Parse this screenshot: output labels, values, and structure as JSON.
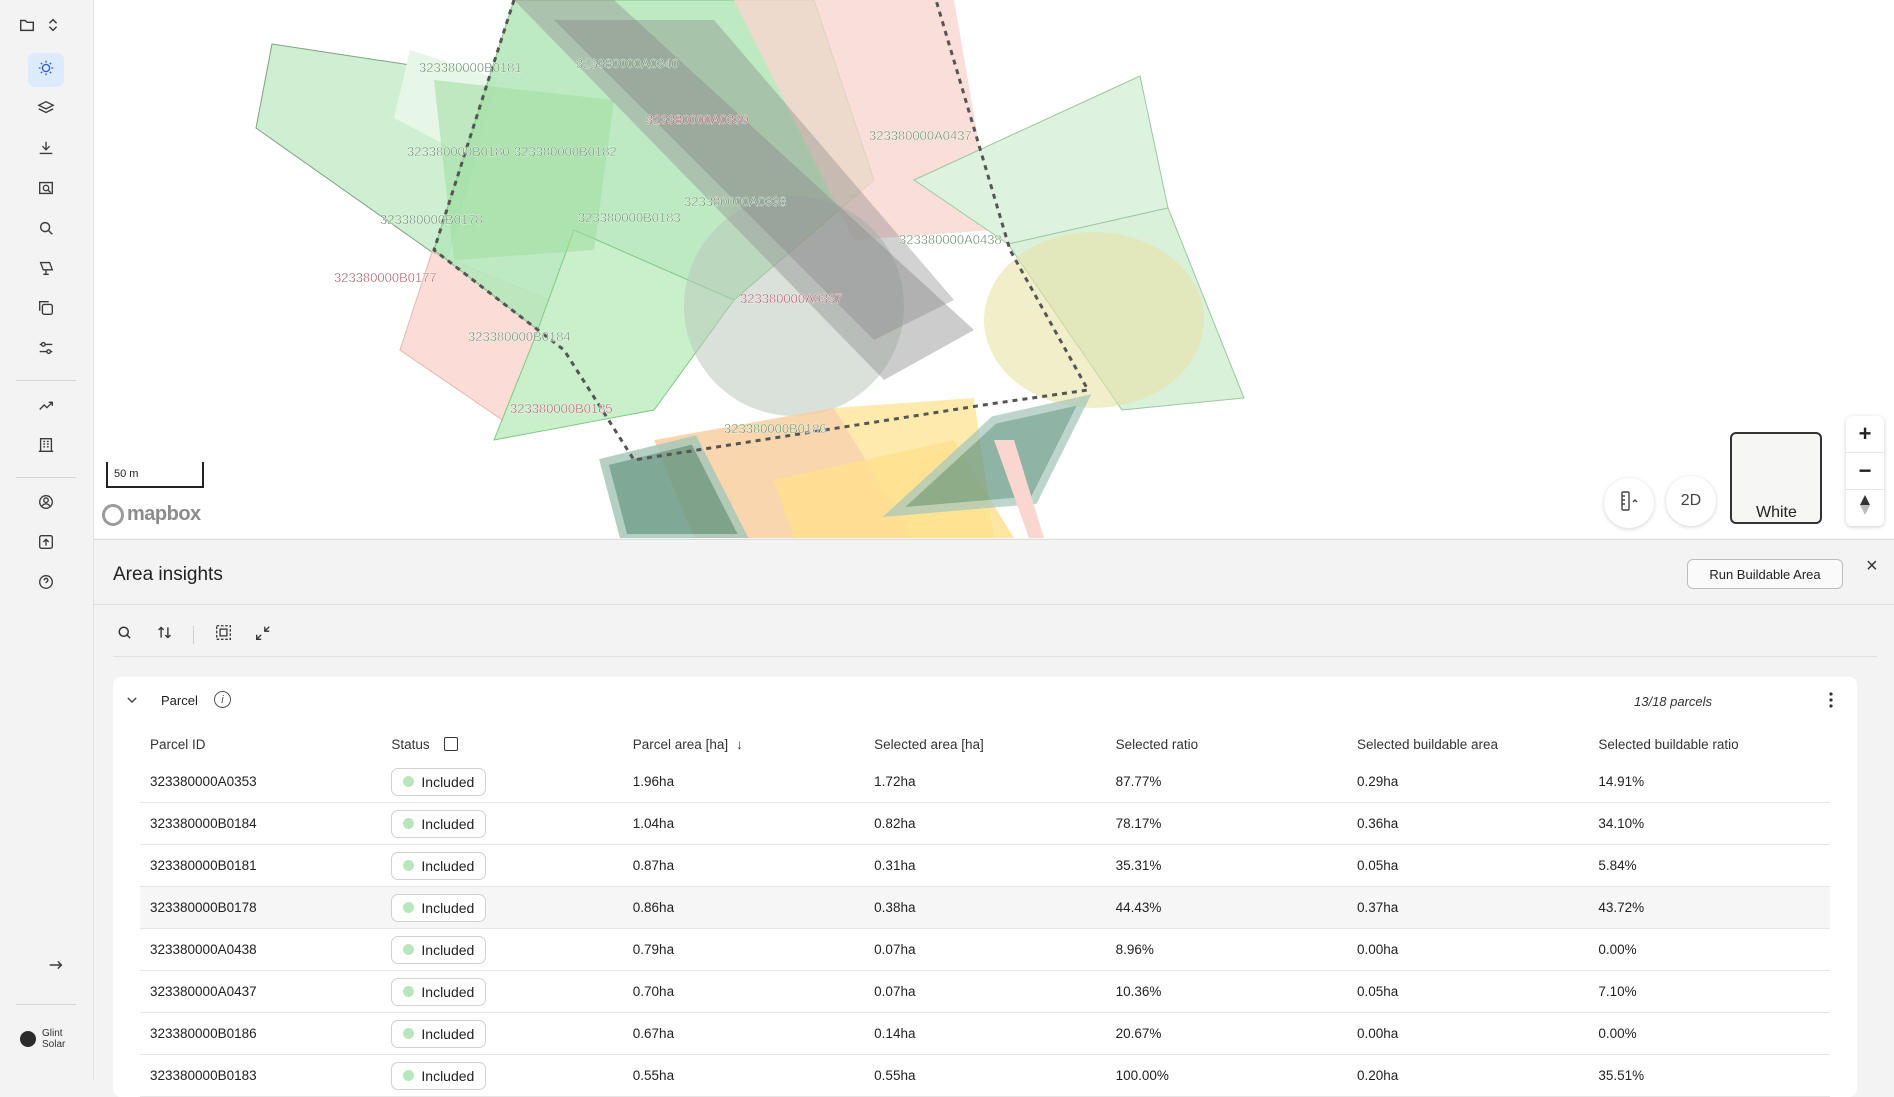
{
  "sidebar": {
    "top": {
      "icon": "folder-icon"
    },
    "items": [
      {
        "name": "insights",
        "icon": "sun-gear-icon",
        "active": true
      },
      {
        "name": "layers",
        "icon": "layers-icon"
      },
      {
        "name": "import",
        "icon": "download-icon"
      },
      {
        "name": "search-area",
        "icon": "map-search-icon"
      },
      {
        "name": "search",
        "icon": "search-icon"
      },
      {
        "name": "solar",
        "icon": "solar-panel-icon"
      },
      {
        "name": "copy",
        "icon": "copy-icon"
      },
      {
        "name": "settings",
        "icon": "sliders-icon"
      },
      {
        "name": "analytics",
        "icon": "trend-icon"
      },
      {
        "name": "buildings",
        "icon": "building-icon"
      },
      {
        "name": "account",
        "icon": "user-icon"
      },
      {
        "name": "export",
        "icon": "upload-icon"
      },
      {
        "name": "help",
        "icon": "help-icon"
      }
    ],
    "brand_line1": "Glint",
    "brand_line2": "Solar"
  },
  "map": {
    "scale_label": "50 m",
    "attribution": "mapbox",
    "view_mode": "2D",
    "base_style": "White",
    "parcel_labels": [
      {
        "id": "323380000B0181",
        "color": "#4a7a4c"
      },
      {
        "id": "323380000A0340",
        "color": "#4a7a4c"
      },
      {
        "id": "323380000A0339",
        "color": "#a13c48"
      },
      {
        "id": "323380000A0437",
        "color": "#4a7a4c"
      },
      {
        "id": "323380000B0180",
        "color": "#4a7a4c"
      },
      {
        "id": "323380000B0182",
        "color": "#4a7a4c"
      },
      {
        "id": "323380000A0338",
        "color": "#4a7a4c"
      },
      {
        "id": "323380000B0183",
        "color": "#4a7a4c"
      },
      {
        "id": "323380000B0178",
        "color": "#4a7a4c"
      },
      {
        "id": "323380000A0438",
        "color": "#4a7a4c"
      },
      {
        "id": "323380000B0177",
        "color": "#a13c48"
      },
      {
        "id": "323380000A0337",
        "color": "#a13c48"
      },
      {
        "id": "323380000B0184",
        "color": "#4a7a4c"
      },
      {
        "id": "323380000B0185",
        "color": "#a13c48"
      },
      {
        "id": "323380000B0186",
        "color": "#4a7a4c"
      }
    ]
  },
  "panel": {
    "title": "Area insights",
    "run_button": "Run Buildable Area",
    "card_title": "Parcel",
    "count": "13/18 parcels",
    "columns": [
      "Parcel ID",
      "Status",
      "Parcel area [ha]",
      "Selected area [ha]",
      "Selected ratio",
      "Selected buildable area",
      "Selected buildable ratio"
    ],
    "sorted_column_indicator": "↓",
    "rows": [
      {
        "id": "323380000A0353",
        "status": "Included",
        "parcel_area": "1.96ha",
        "selected_area": "1.72ha",
        "selected_ratio": "87.77%",
        "buildable_area": "0.29ha",
        "buildable_ratio": "14.91%"
      },
      {
        "id": "323380000B0184",
        "status": "Included",
        "parcel_area": "1.04ha",
        "selected_area": "0.82ha",
        "selected_ratio": "78.17%",
        "buildable_area": "0.36ha",
        "buildable_ratio": "34.10%"
      },
      {
        "id": "323380000B0181",
        "status": "Included",
        "parcel_area": "0.87ha",
        "selected_area": "0.31ha",
        "selected_ratio": "35.31%",
        "buildable_area": "0.05ha",
        "buildable_ratio": "5.84%"
      },
      {
        "id": "323380000B0178",
        "status": "Included",
        "parcel_area": "0.86ha",
        "selected_area": "0.38ha",
        "selected_ratio": "44.43%",
        "buildable_area": "0.37ha",
        "buildable_ratio": "43.72%"
      },
      {
        "id": "323380000A0438",
        "status": "Included",
        "parcel_area": "0.79ha",
        "selected_area": "0.07ha",
        "selected_ratio": "8.96%",
        "buildable_area": "0.00ha",
        "buildable_ratio": "0.00%"
      },
      {
        "id": "323380000A0437",
        "status": "Included",
        "parcel_area": "0.70ha",
        "selected_area": "0.07ha",
        "selected_ratio": "10.36%",
        "buildable_area": "0.05ha",
        "buildable_ratio": "7.10%"
      },
      {
        "id": "323380000B0186",
        "status": "Included",
        "parcel_area": "0.67ha",
        "selected_area": "0.14ha",
        "selected_ratio": "20.67%",
        "buildable_area": "0.00ha",
        "buildable_ratio": "0.00%"
      },
      {
        "id": "323380000B0183",
        "status": "Included",
        "parcel_area": "0.55ha",
        "selected_area": "0.55ha",
        "selected_ratio": "100.00%",
        "buildable_area": "0.20ha",
        "buildable_ratio": "35.51%"
      }
    ]
  }
}
